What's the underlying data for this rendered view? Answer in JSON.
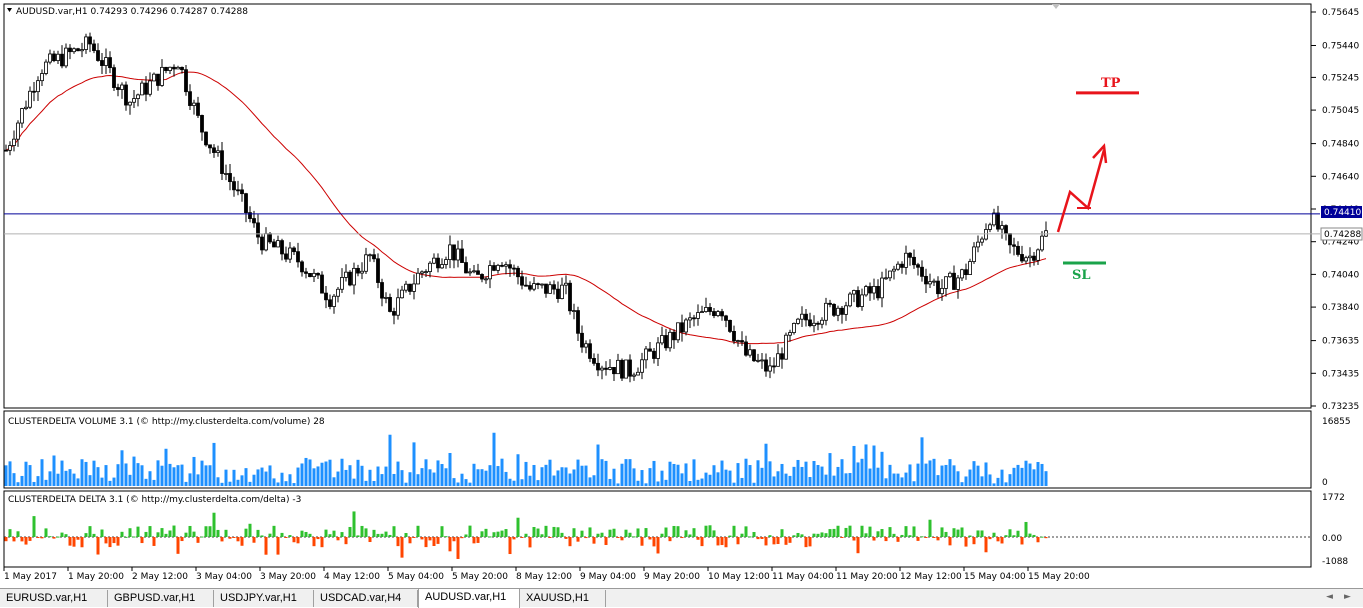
{
  "main": {
    "symbol_header": "AUDUSD.var,H1  0.74293 0.74296 0.74287 0.74288",
    "bid_label": "0.74288",
    "hline_label": "0.74410",
    "price_ticks": [
      "0.75645",
      "0.75440",
      "0.75245",
      "0.75045",
      "0.74840",
      "0.74640",
      "0.74440",
      "0.74240",
      "0.74040",
      "0.73840",
      "0.73635",
      "0.73435",
      "0.73235"
    ],
    "tp_label": "TP",
    "sl_label": "SL",
    "colors": {
      "bull_bear": "#000000",
      "ma": "#cc0000",
      "hline": "#000099",
      "tp": "#e8141b",
      "sl": "#1aa34a",
      "bid_line": "#b0b0b0",
      "vol_bars": "#1e90ff",
      "delta_pos": "#2ec12e",
      "delta_neg": "#ff4500"
    }
  },
  "volume_pane": {
    "title": "CLUSTERDELTA VOLUME 3.1 (© http://my.clusterdelta.com/volume) 28",
    "ticks": [
      "16855",
      "0"
    ]
  },
  "delta_pane": {
    "title": "CLUSTERDELTA DELTA 3.1 (© http://my.clusterdelta.com/delta) -3",
    "ticks": [
      "1772",
      "0.00",
      "-1088"
    ]
  },
  "time_axis": [
    "1 May 2017",
    "1 May 20:00",
    "2 May 12:00",
    "3 May 04:00",
    "3 May 20:00",
    "4 May 12:00",
    "5 May 04:00",
    "5 May 20:00",
    "8 May 12:00",
    "9 May 04:00",
    "9 May 20:00",
    "10 May 12:00",
    "11 May 04:00",
    "11 May 20:00",
    "12 May 12:00",
    "15 May 04:00",
    "15 May 20:00"
  ],
  "tabs": [
    "EURUSD.var,H1",
    "GBPUSD.var,H1",
    "USDJPY.var,H1",
    "USDCAD.var,H4",
    "AUDUSD.var,H1",
    "XAUUSD,H1"
  ],
  "active_tab": "AUDUSD.var,H1",
  "chart_data": {
    "type": "line",
    "title": "AUDUSD.var,H1",
    "xlabel": "",
    "ylabel": "",
    "x": [
      "1 May 2017",
      "1 May 20:00",
      "2 May 12:00",
      "3 May 04:00",
      "3 May 20:00",
      "4 May 12:00",
      "5 May 04:00",
      "5 May 20:00",
      "8 May 12:00",
      "9 May 04:00",
      "9 May 20:00",
      "10 May 12:00",
      "11 May 04:00",
      "11 May 20:00",
      "12 May 12:00",
      "15 May 04:00",
      "15 May 20:00"
    ],
    "series": [
      {
        "values": [
          0.748,
          0.7541,
          0.7515,
          0.751,
          0.7425,
          0.7385,
          0.7405,
          0.741,
          0.739,
          0.7345,
          0.736,
          0.7375,
          0.7365,
          0.738,
          0.7395,
          0.744,
          0.7429
        ]
      }
    ],
    "ylim": [
      0.73235,
      0.75645
    ],
    "levels": {
      "hline": 0.7441,
      "bid": 0.74288,
      "tp": 0.7515,
      "sl": 0.7411
    }
  }
}
